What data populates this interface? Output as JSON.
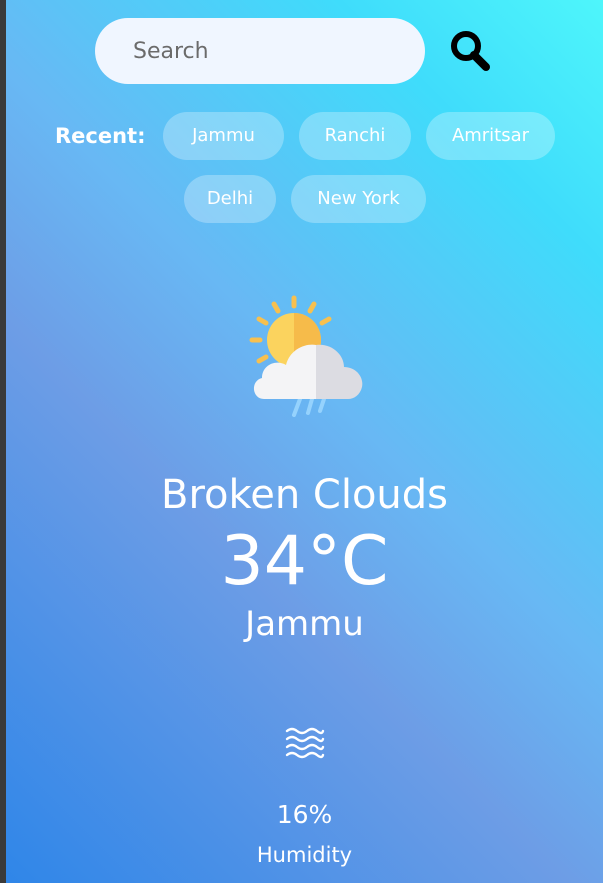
{
  "search": {
    "placeholder": "Search",
    "value": "",
    "button_icon": "search-icon"
  },
  "recent": {
    "label": "Recent:",
    "cities": [
      "Jammu",
      "Ranchi",
      "Amritsar",
      "Delhi",
      "New York"
    ]
  },
  "weather": {
    "icon": "partly-cloudy-rain-icon",
    "condition": "Broken Clouds",
    "temperature": "34°C",
    "city": "Jammu"
  },
  "humidity": {
    "icon": "waves-icon",
    "value": "16%",
    "label": "Humidity"
  },
  "colors": {
    "gradient_top_right": "#4ef6fb",
    "gradient_bottom_left": "#2f86e8",
    "search_bg": "#f0f6ff",
    "text": "#ffffff"
  }
}
